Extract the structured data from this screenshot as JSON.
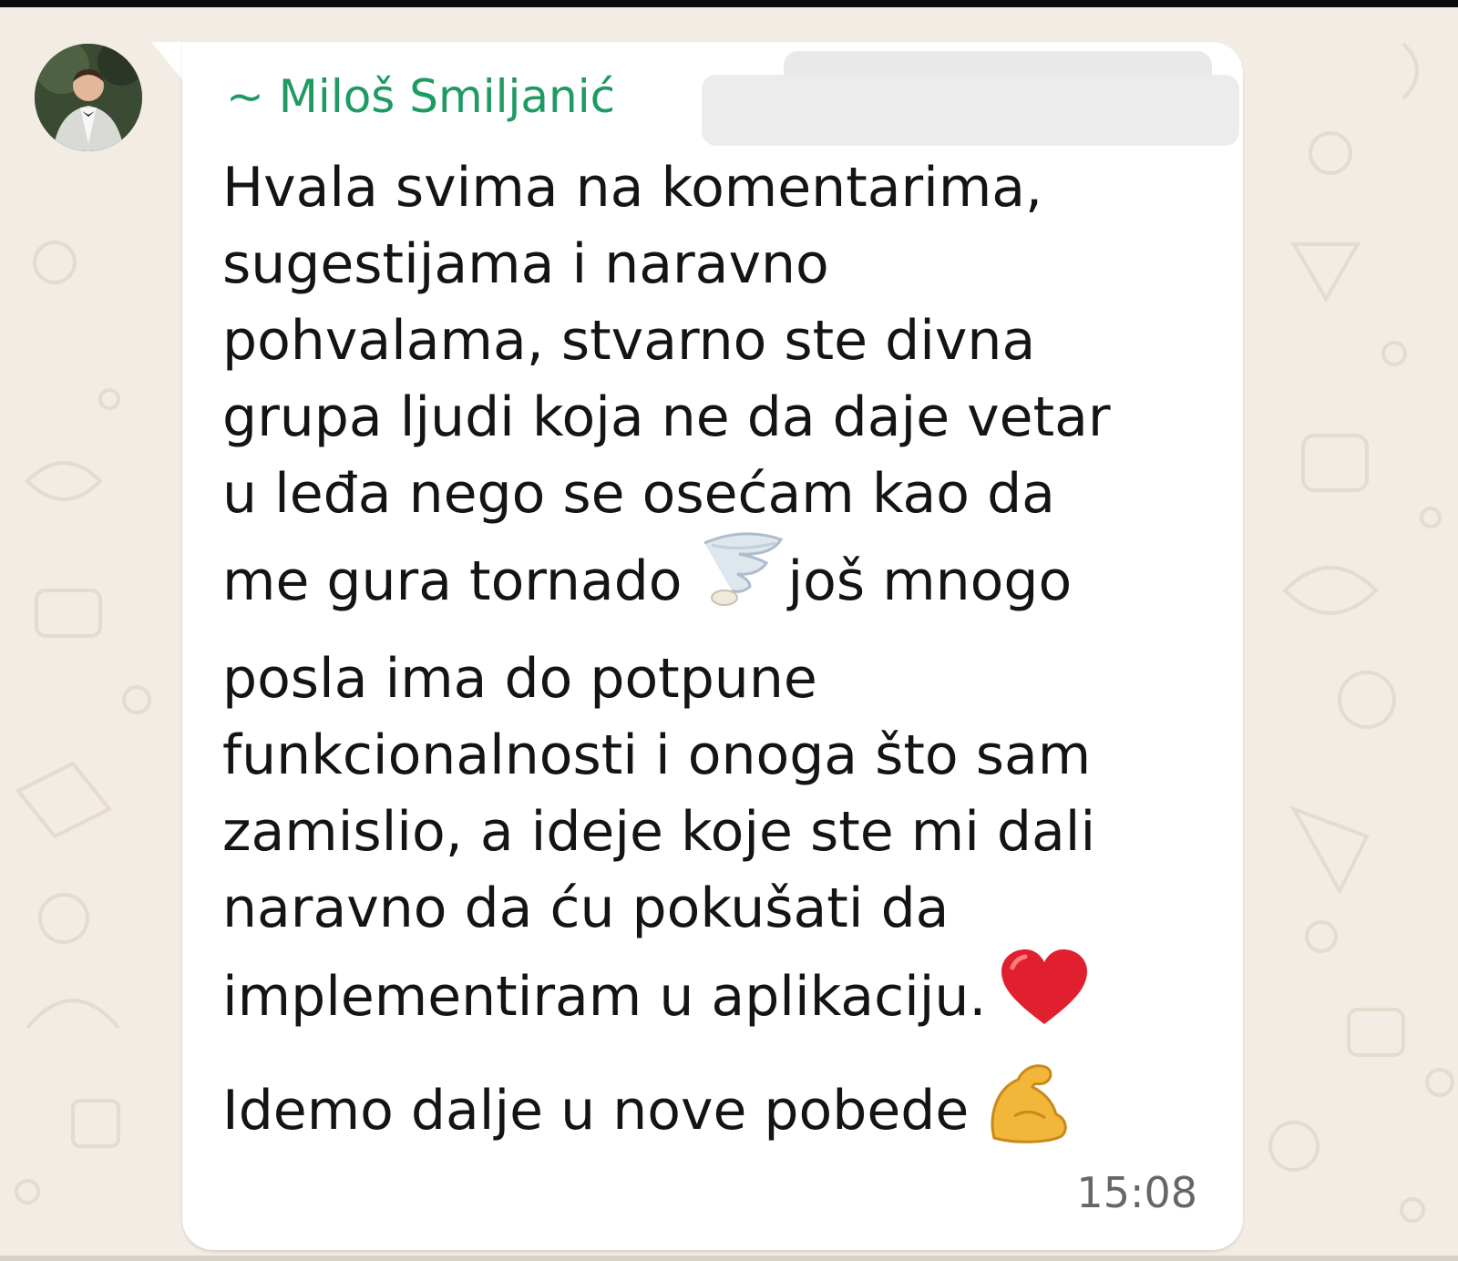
{
  "message": {
    "sender": "~ Miloš Smiljanić",
    "lines": {
      "l1": "Hvala svima na komentarima,",
      "l2": "sugestijama i naravno",
      "l3": "pohvalama, stvarno ste divna",
      "l4": "grupa ljudi koja ne da daje vetar",
      "l5": "u leđa nego se osećam kao da",
      "l6a": "me gura tornado",
      "l6b": "još mnogo",
      "l7": "posla ima do potpune",
      "l8": "funkcionalnosti i onoga što sam",
      "l9": "zamislio, a ideje koje ste mi dali",
      "l10": "naravno da ću pokušati da",
      "l11": "implementiram u aplikaciju.",
      "l12": "Idemo dalje u nove pobede"
    },
    "emojis": [
      "tornado-emoji",
      "red-heart-emoji",
      "flexed-biceps-emoji"
    ],
    "time": "15:08"
  },
  "colors": {
    "sender": "#1f9a62",
    "bubble": "#ffffff",
    "wallpaper": "#f2ece4",
    "doodle": "#e5dbcf",
    "timestamp": "#666666"
  }
}
